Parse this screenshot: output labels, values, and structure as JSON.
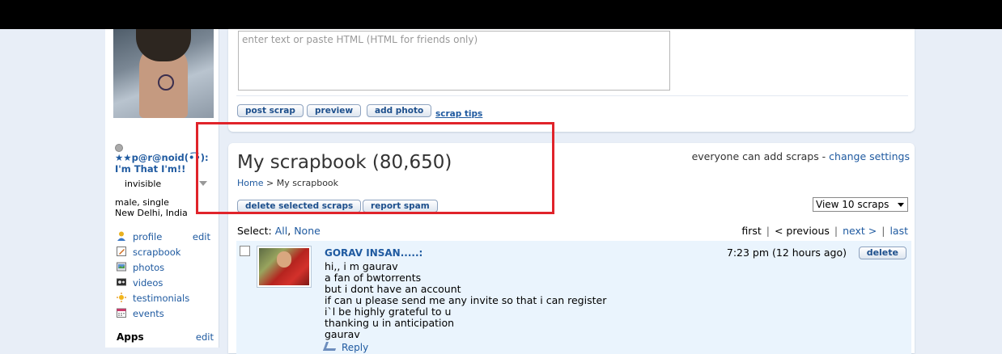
{
  "compose": {
    "placeholder": "enter text or paste HTML (HTML for friends only)",
    "buttons": [
      "post scrap",
      "preview",
      "add photo"
    ],
    "tips_link": "scrap tips"
  },
  "profile": {
    "name": "★★p@r@noid(•͡•): I'm That I'm!!",
    "presence": "invisible",
    "gender_status": "male, single",
    "location": "New Delhi, India",
    "nav": [
      {
        "label": "profile",
        "edit": "edit",
        "icon": "person-icon"
      },
      {
        "label": "scrapbook",
        "edit": "",
        "icon": "pencil-icon"
      },
      {
        "label": "photos",
        "edit": "",
        "icon": "camera-icon"
      },
      {
        "label": "videos",
        "edit": "",
        "icon": "video-icon"
      },
      {
        "label": "testimonials",
        "edit": "",
        "icon": "sun-icon"
      },
      {
        "label": "events",
        "edit": "",
        "icon": "calendar-icon"
      }
    ],
    "apps_label": "Apps",
    "apps_edit": "edit"
  },
  "scrapbook": {
    "title": "My scrapbook (80,650)",
    "settings_text": "everyone can add scraps - ",
    "settings_link": "change settings",
    "breadcrumb": {
      "home": "Home",
      "sep": " > ",
      "current": "My scrapbook"
    },
    "delete_selected": "delete selected scraps",
    "report_spam": "report spam",
    "view_select": "View 10 scraps",
    "select_label": "Select: ",
    "select_all": "All",
    "select_sep": ", ",
    "select_none": "None",
    "pager": {
      "first": "first",
      "prev": "< previous",
      "next": "next >",
      "last": "last"
    },
    "scraps": [
      {
        "author": "GORAV INSAN.....:",
        "time": "7:23 pm (12 hours ago)",
        "delete": "delete",
        "lines": [
          "hi,, i m gaurav",
          "a fan of bwtorrents",
          "but i dont have an account",
          "if can u please send me any invite so that i can register",
          "i`l be highly grateful to u",
          "thanking u in anticipation",
          "gaurav"
        ],
        "reply": "Reply"
      }
    ]
  },
  "colors": {
    "link": "#1f5aa0",
    "highlight": "#e0232a",
    "scrap_bg": "#eaf4fd",
    "page_bg": "#e8eef7"
  }
}
